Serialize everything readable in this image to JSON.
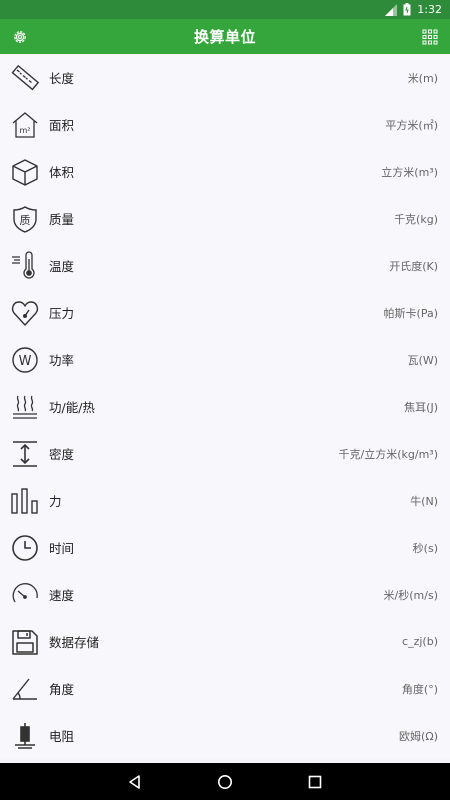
{
  "status": {
    "time": "1:32"
  },
  "appbar": {
    "title": "换算单位",
    "settings_icon": "gear-icon",
    "menu_icon": "grid-icon"
  },
  "items": [
    {
      "label": "长度",
      "unit": "米(m)",
      "icon": "ruler-icon"
    },
    {
      "label": "面积",
      "unit": "平方米(㎡)",
      "icon": "house-area-icon"
    },
    {
      "label": "体积",
      "unit": "立方米(m³)",
      "icon": "cube-icon"
    },
    {
      "label": "质量",
      "unit": "千克(kg)",
      "icon": "quality-shield-icon"
    },
    {
      "label": "温度",
      "unit": "开氏度(K)",
      "icon": "thermometer-icon"
    },
    {
      "label": "压力",
      "unit": "帕斯卡(Pa)",
      "icon": "heart-gauge-icon"
    },
    {
      "label": "功率",
      "unit": "瓦(W)",
      "icon": "watt-circle-icon"
    },
    {
      "label": "功/能/热",
      "unit": "焦耳(J)",
      "icon": "heat-waves-icon"
    },
    {
      "label": "密度",
      "unit": "千克/立方米(kg/m³)",
      "icon": "density-arrow-icon"
    },
    {
      "label": "力",
      "unit": "牛(N)",
      "icon": "bars-icon"
    },
    {
      "label": "时间",
      "unit": "秒(s)",
      "icon": "clock-icon"
    },
    {
      "label": "速度",
      "unit": "米/秒(m/s)",
      "icon": "speedometer-icon"
    },
    {
      "label": "数据存储",
      "unit": "c_zj(b)",
      "icon": "floppy-disk-icon"
    },
    {
      "label": "角度",
      "unit": "角度(°)",
      "icon": "angle-icon"
    },
    {
      "label": "电阻",
      "unit": "欧姆(Ω)",
      "icon": "resistor-icon"
    }
  ]
}
